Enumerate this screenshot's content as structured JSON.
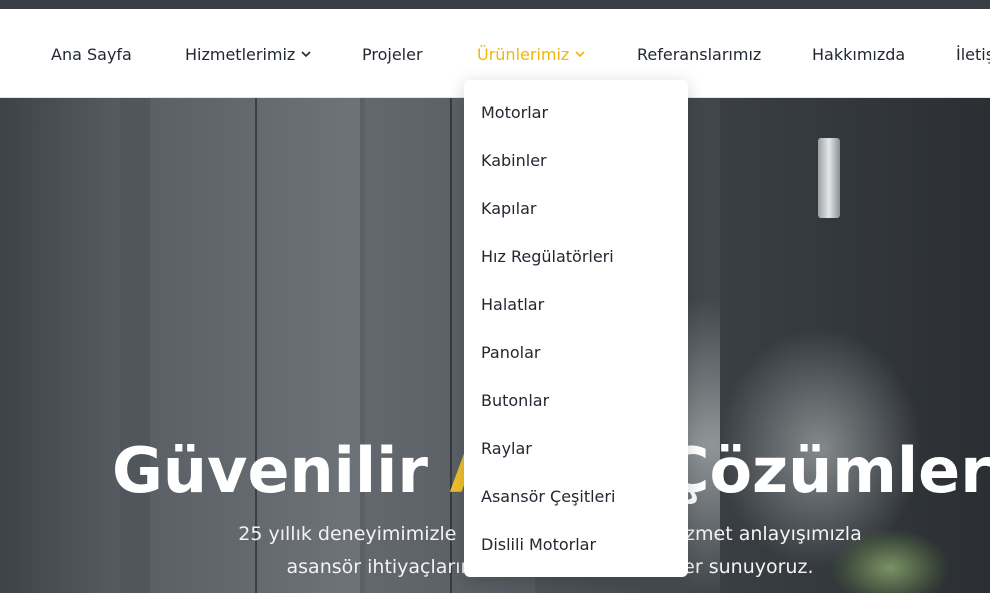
{
  "nav": {
    "items": [
      {
        "label": "Ana Sayfa",
        "has_dropdown": false,
        "active": false
      },
      {
        "label": "Hizmetlerimiz",
        "has_dropdown": true,
        "active": false
      },
      {
        "label": "Projeler",
        "has_dropdown": false,
        "active": false
      },
      {
        "label": "Ürünlerimiz",
        "has_dropdown": true,
        "active": true
      },
      {
        "label": "Referanslarımız",
        "has_dropdown": false,
        "active": false
      },
      {
        "label": "Hakkımızda",
        "has_dropdown": false,
        "active": false
      },
      {
        "label": "İletiş",
        "has_dropdown": false,
        "active": false
      }
    ]
  },
  "dropdown": {
    "items": [
      "Motorlar",
      "Kabinler",
      "Kapılar",
      "Hız Regülatörleri",
      "Halatlar",
      "Panolar",
      "Butonlar",
      "Raylar",
      "Asansör Çeşitleri",
      "Dislili Motorlar"
    ]
  },
  "hero": {
    "title_part1": "Güvenilir ",
    "title_highlight": "As",
    "title_part2": "      Çözümleri",
    "subtitle_line1": "25 yıllık deneyimimizle mo                             hizmet anlayışımızla",
    "subtitle_line2": "asansör ihtiyaçlarını                                  er sunuyoruz."
  },
  "colors": {
    "accent": "#f2b705",
    "text": "#222831",
    "hero_highlight": "#f2c12e"
  }
}
